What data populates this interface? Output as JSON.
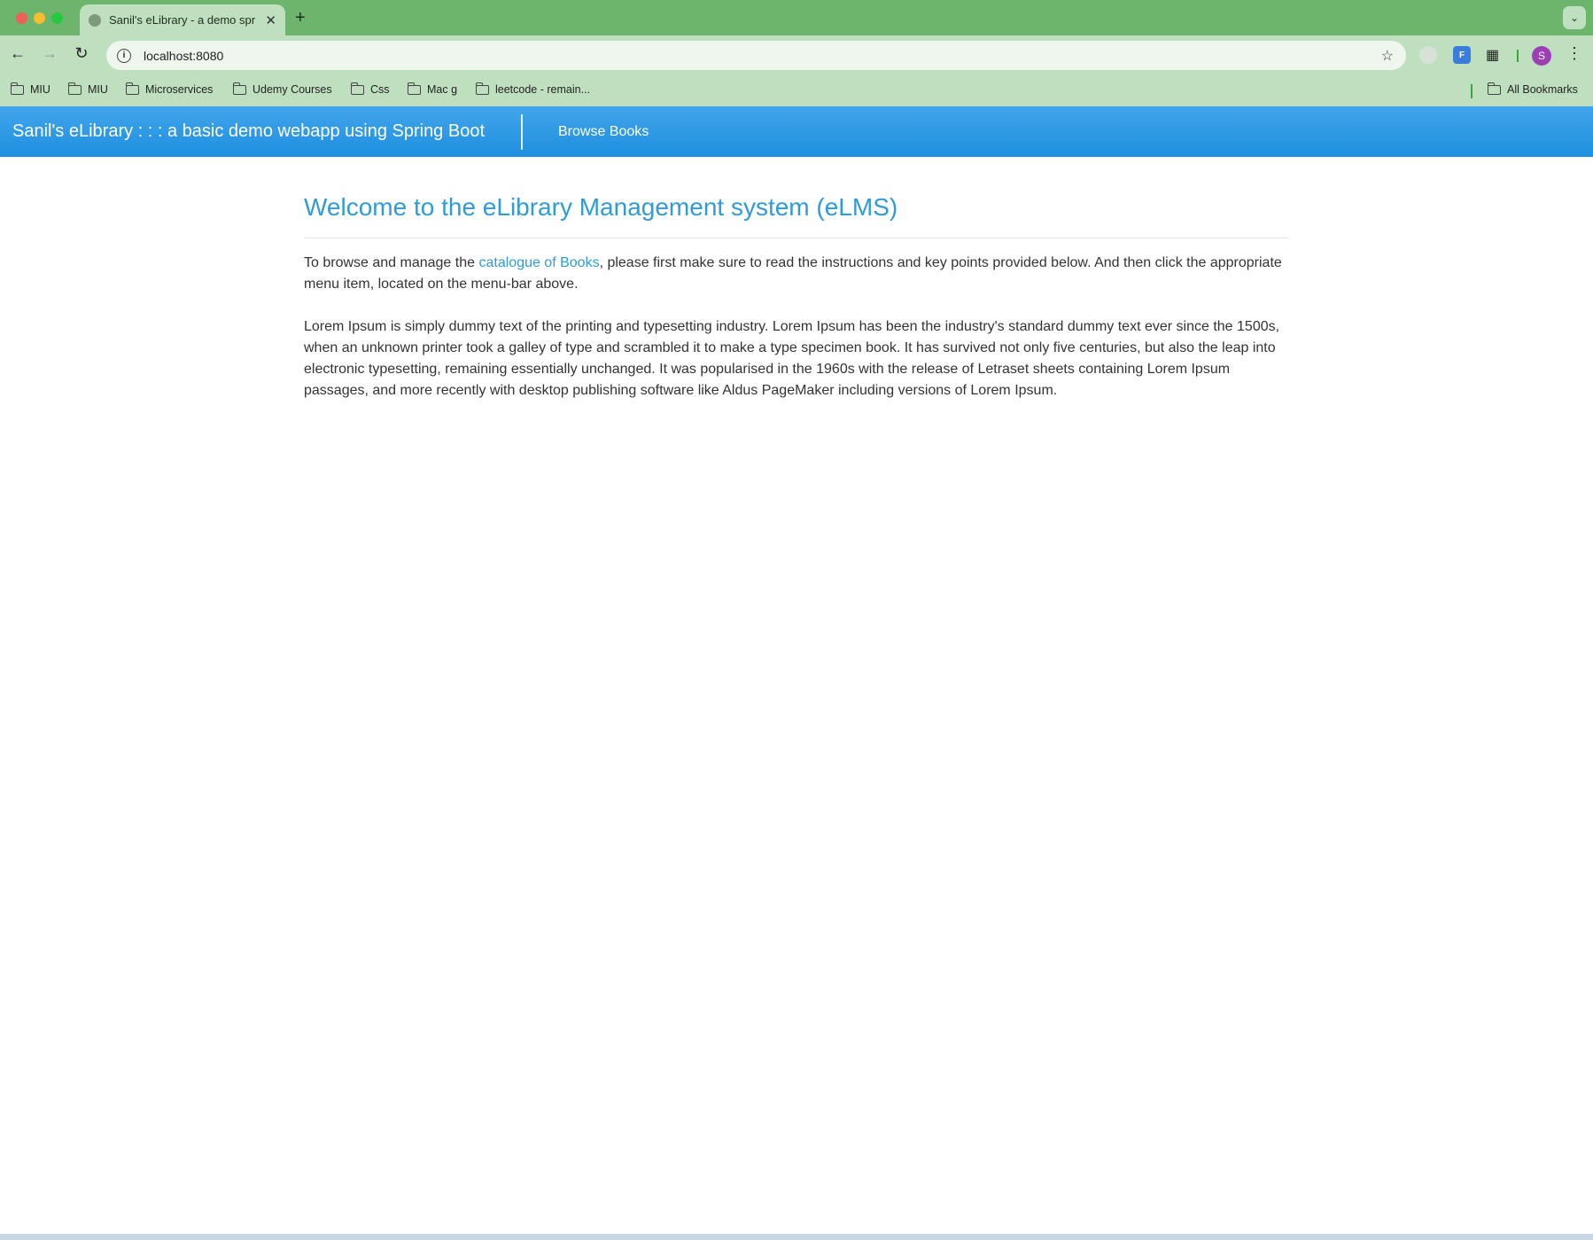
{
  "browser": {
    "tab_title": "Sanil's eLibrary - a demo spr",
    "tab_close": "✕",
    "new_tab": "+",
    "url": "localhost:8080",
    "avatar_letter": "S",
    "ext_2_label": "F",
    "bookmarks": [
      "MIU",
      "MIU",
      "Microservices",
      "Udemy Courses",
      "Css",
      "Mac g",
      "leetcode - remain..."
    ],
    "all_bookmarks": "All Bookmarks"
  },
  "appbar": {
    "brand": "Sanil's eLibrary : : : a basic demo webapp using Spring Boot",
    "menu_browse": "Browse Books"
  },
  "main": {
    "heading": "Welcome to the eLibrary Management system (eLMS)",
    "intro_before": "To browse and manage the ",
    "intro_link": "catalogue of Books",
    "intro_after": ", please first make sure to read the instructions and key points provided below. And then click the appropriate menu item, located on the menu-bar above.",
    "lorem": "Lorem Ipsum is simply dummy text of the printing and typesetting industry. Lorem Ipsum has been the industry's standard dummy text ever since the 1500s, when an unknown printer took a galley of type and scrambled it to make a type specimen book. It has survived not only five centuries, but also the leap into electronic typesetting, remaining essentially unchanged. It was popularised in the 1960s with the release of Letraset sheets containing Lorem Ipsum passages, and more recently with desktop publishing software like Aldus PageMaker including versions of Lorem Ipsum."
  },
  "colors": {
    "tabbar": "#6db56d",
    "toolbar": "#bfe0bf",
    "appbar": "#2196e6",
    "accent": "#2f9bd9"
  }
}
